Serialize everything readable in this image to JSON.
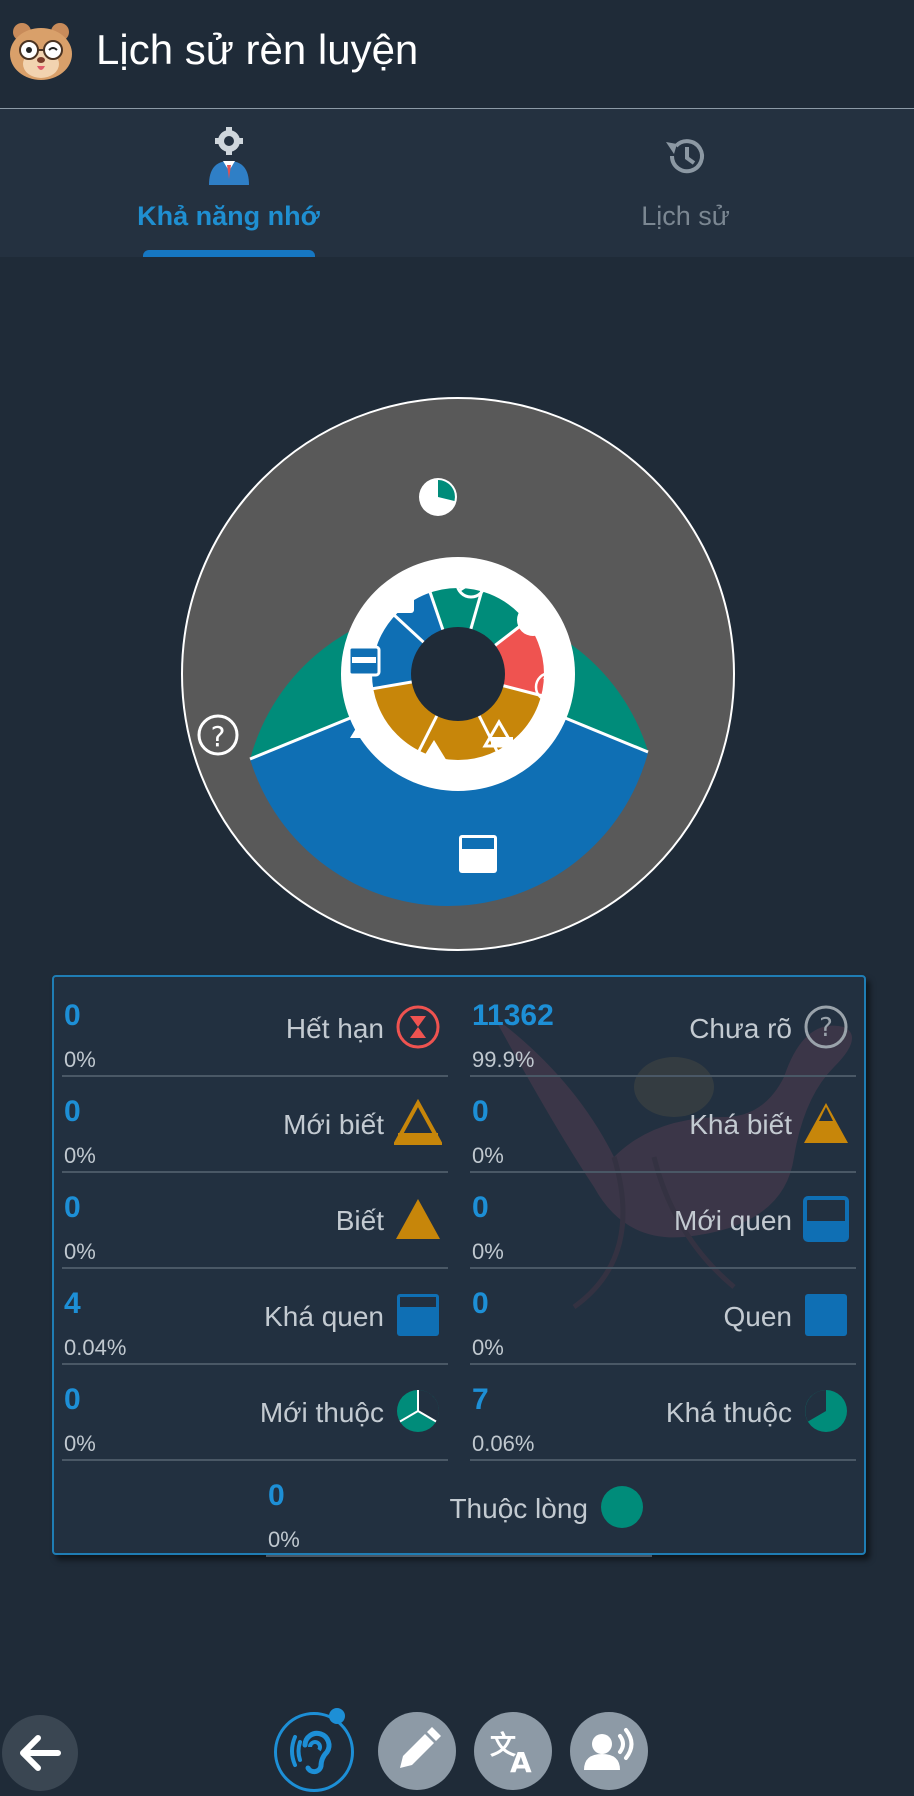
{
  "header": {
    "title": "Lịch sử rèn luyện",
    "logo_icon": "hamster-mascot-icon"
  },
  "tabs": [
    {
      "label": "Khả năng nhớ",
      "icon": "memory-user-gear-icon",
      "active": true
    },
    {
      "label": "Lịch sử",
      "icon": "history-icon",
      "active": false
    }
  ],
  "colors": {
    "accent": "#1d8fd6",
    "expired": "#ef5350",
    "learning": "#c7860a",
    "familiar": "#0f6fb4",
    "memorized": "#008c7a",
    "unknown": "#595959"
  },
  "stats": [
    {
      "count": "0",
      "percent": "0%",
      "label": "Hết hạn",
      "icon": "hourglass-icon"
    },
    {
      "count": "11362",
      "percent": "99.9%",
      "label": "Chưa rõ",
      "icon": "question-icon"
    },
    {
      "count": "0",
      "percent": "0%",
      "label": "Mới biết",
      "icon": "triangle-low-icon"
    },
    {
      "count": "0",
      "percent": "0%",
      "label": "Khá biết",
      "icon": "triangle-half-icon"
    },
    {
      "count": "0",
      "percent": "0%",
      "label": "Biết",
      "icon": "triangle-full-icon"
    },
    {
      "count": "0",
      "percent": "0%",
      "label": "Mới quen",
      "icon": "square-low-icon"
    },
    {
      "count": "4",
      "percent": "0.04%",
      "label": "Khá quen",
      "icon": "square-half-icon"
    },
    {
      "count": "0",
      "percent": "0%",
      "label": "Quen",
      "icon": "square-full-icon"
    },
    {
      "count": "0",
      "percent": "0%",
      "label": "Mới thuộc",
      "icon": "circle-third-icon"
    },
    {
      "count": "7",
      "percent": "0.06%",
      "label": "Khá thuộc",
      "icon": "circle-twothird-icon"
    },
    {
      "count": "0",
      "percent": "0%",
      "label": "Thuộc lòng",
      "icon": "circle-full-icon"
    }
  ],
  "bottom_bar": [
    "back-arrow-icon",
    "listen-ear-icon",
    "pencil-icon",
    "translate-icon",
    "speak-icon"
  ]
}
